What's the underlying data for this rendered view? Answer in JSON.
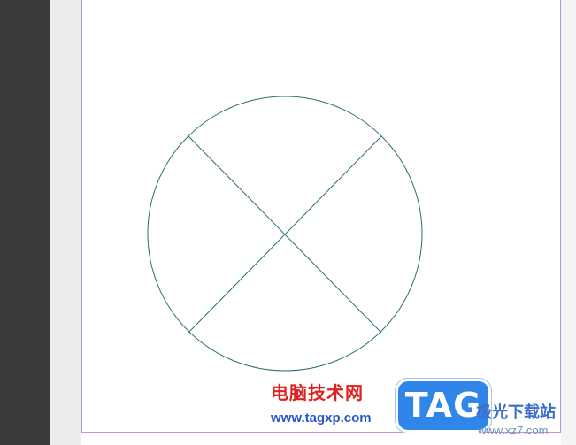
{
  "watermark": {
    "site_cn": "电脑技术网",
    "site_url": "www.tagxp.com",
    "tag_badge": "TAG",
    "partner_cn": "极光下载站",
    "partner_url": "www.xz7.com"
  },
  "colors": {
    "canvas_left_dark": "#3b3b3b",
    "page_border": "#b39ad6",
    "shape_stroke": "#2f6f73",
    "watermark_red": "#e0201e",
    "watermark_blue": "#2a56c6",
    "tag_badge_blue": "#2f86e8"
  },
  "icons": [
    "circle-shape",
    "cross-lines"
  ]
}
